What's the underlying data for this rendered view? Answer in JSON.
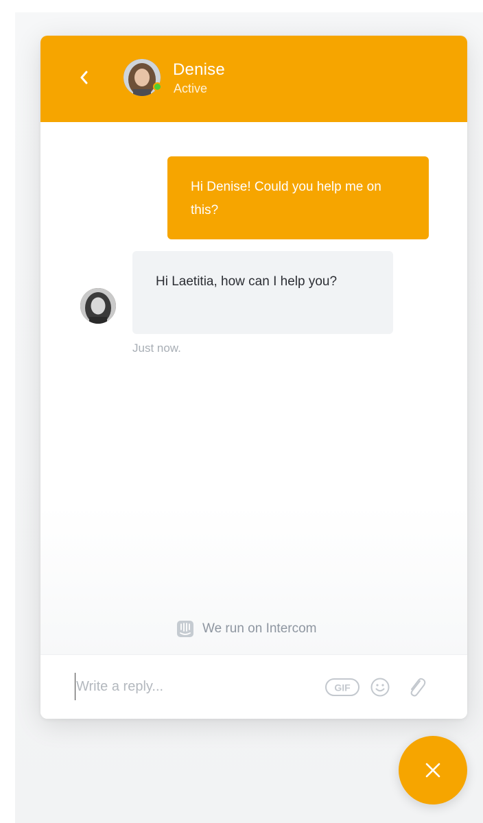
{
  "colors": {
    "accent": "#f6a500",
    "online": "#4fce35",
    "incoming_bubble": "#f1f3f5"
  },
  "header": {
    "back_icon": "chevron-left-icon",
    "agent_name": "Denise",
    "agent_status": "Active"
  },
  "conversation": {
    "outgoing_message": "Hi Denise! Could you help me on this?",
    "incoming_message": "Hi Laetitia, how can I help you?",
    "timestamp": "Just now."
  },
  "footer": {
    "powered_icon": "intercom-logo-icon",
    "powered_text": "We run on Intercom"
  },
  "composer": {
    "placeholder": "Write a reply...",
    "value": "",
    "gif_label": "GIF",
    "emoji_icon": "smiley-icon",
    "attach_icon": "paperclip-icon"
  },
  "launcher": {
    "icon": "close-icon"
  }
}
